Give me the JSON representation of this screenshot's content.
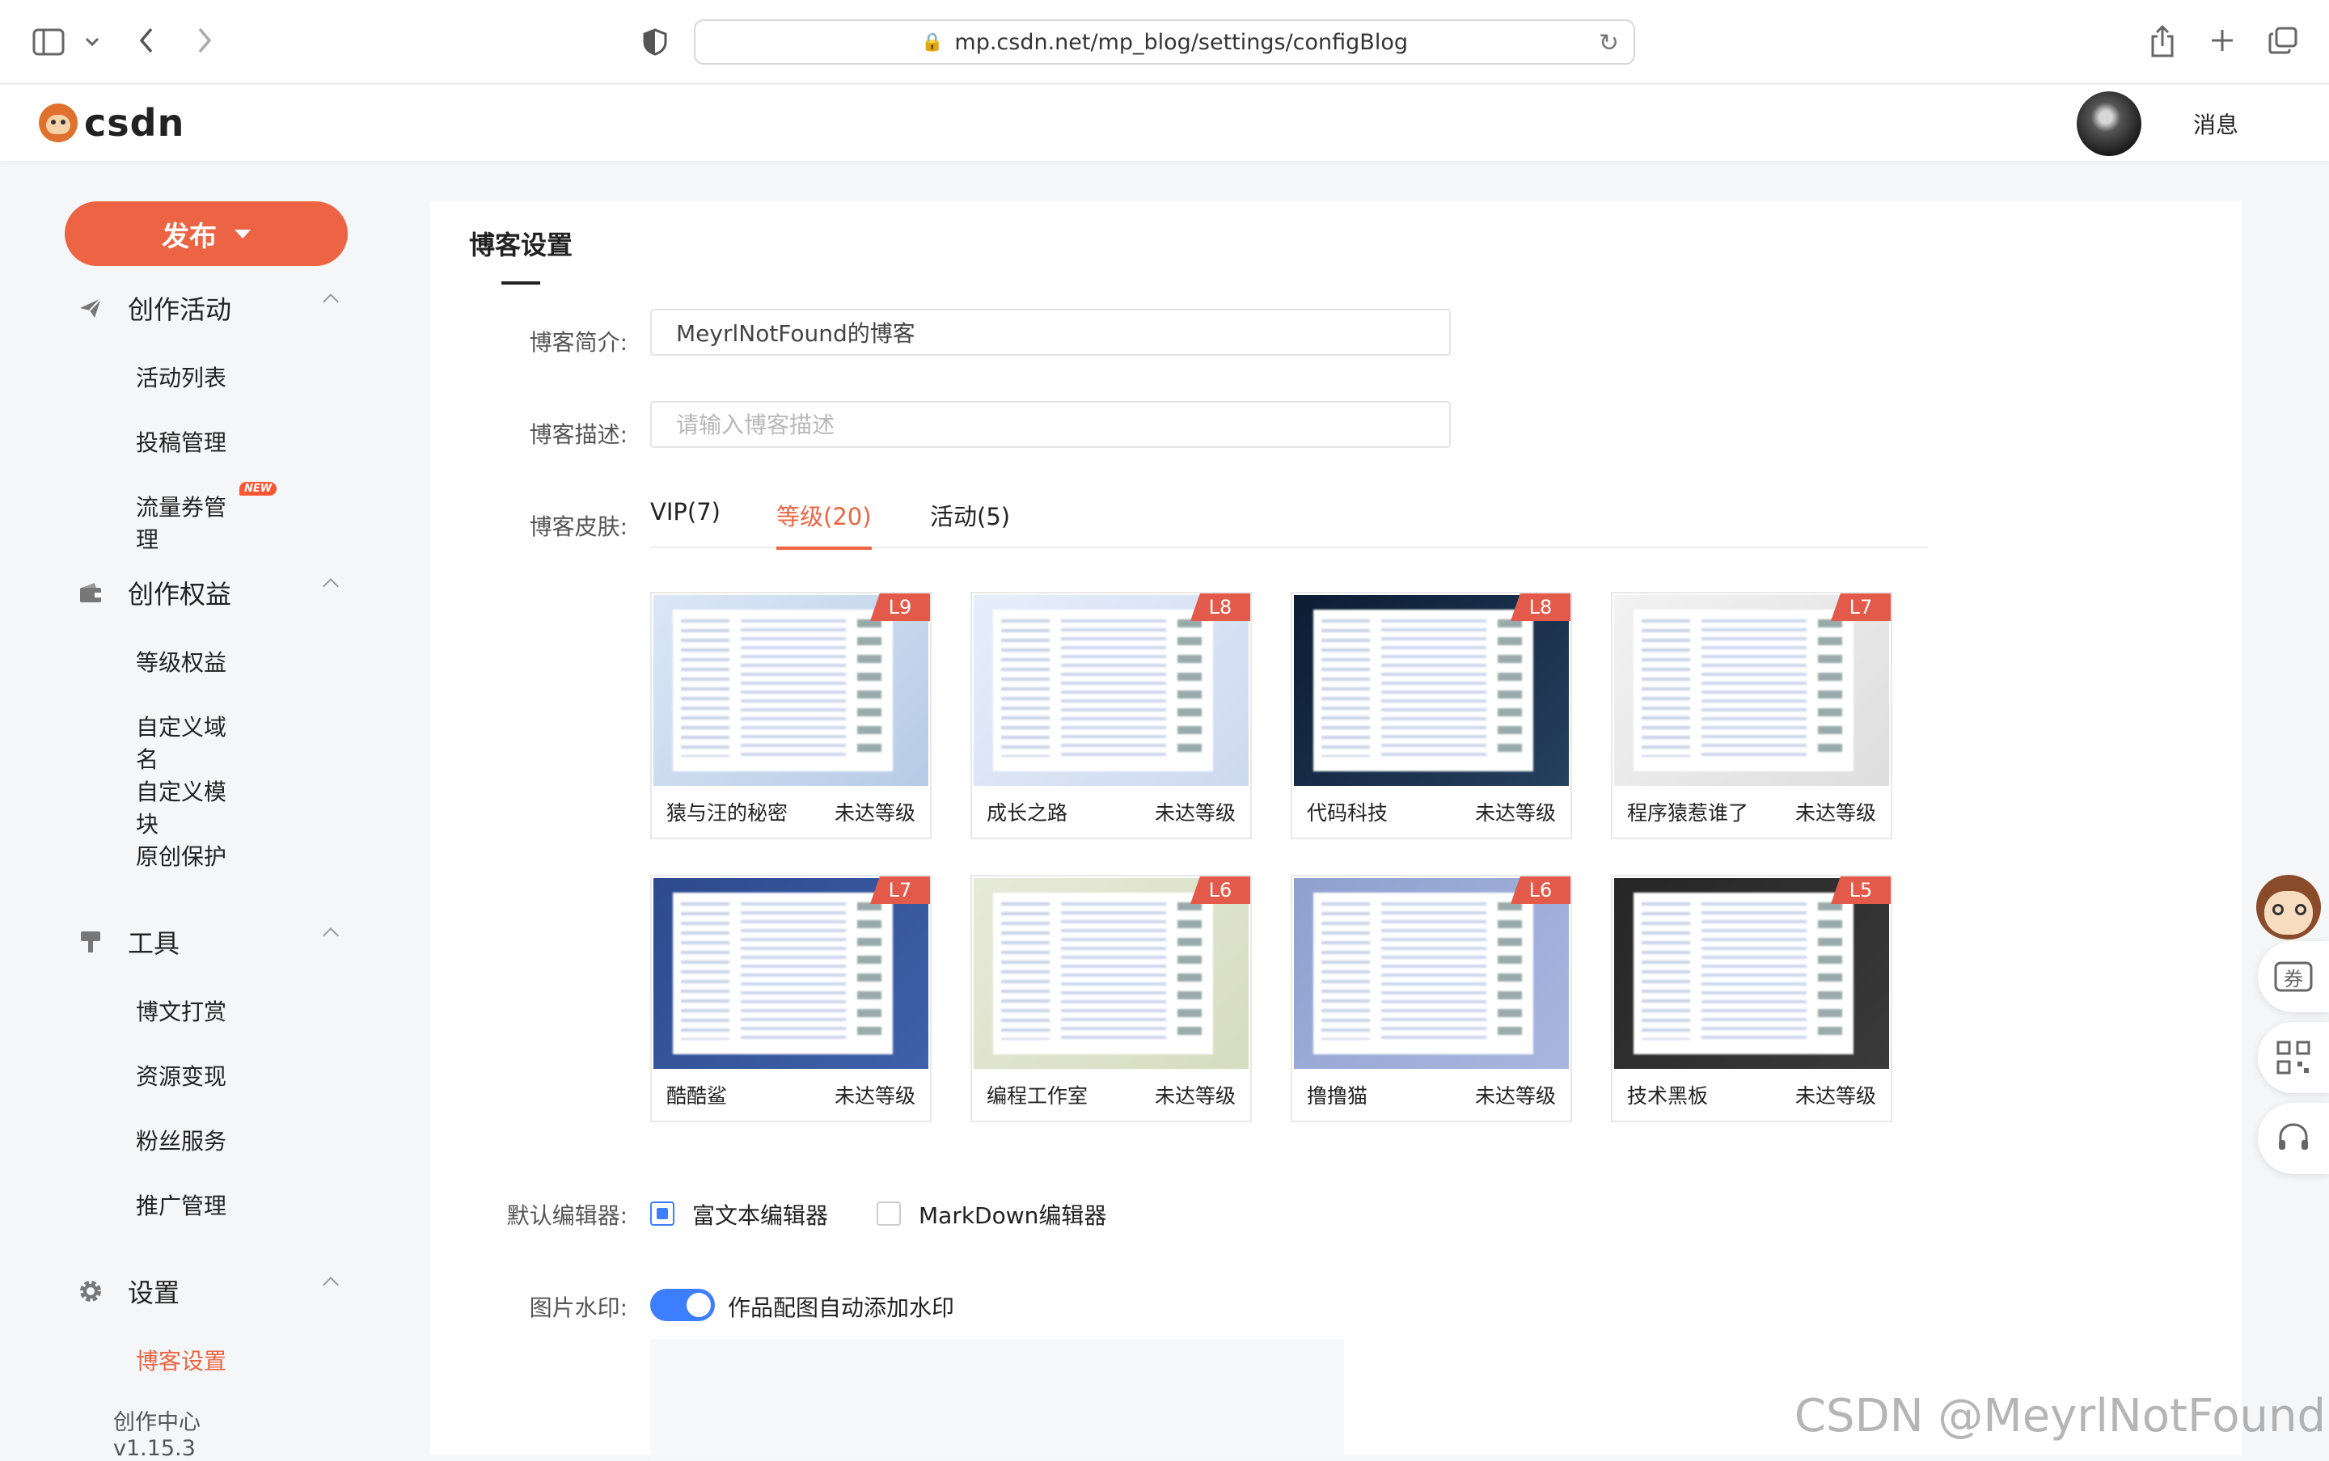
{
  "browser": {
    "url": "mp.csdn.net/mp_blog/settings/configBlog"
  },
  "header": {
    "logo_text": "csdn",
    "messages_label": "消息"
  },
  "sidebar": {
    "publish_label": "发布",
    "sections": [
      {
        "title": "创作活动",
        "icon": "paper-plane-icon",
        "items": [
          {
            "label": "活动列表"
          },
          {
            "label": "投稿管理"
          },
          {
            "label": "流量券管理",
            "badge": "NEW"
          }
        ]
      },
      {
        "title": "创作权益",
        "icon": "wallet-icon",
        "items": [
          {
            "label": "等级权益"
          },
          {
            "label": "自定义域名"
          },
          {
            "label": "自定义模块"
          },
          {
            "label": "原创保护"
          }
        ]
      },
      {
        "title": "工具",
        "icon": "tools-icon",
        "items": [
          {
            "label": "博文打赏"
          },
          {
            "label": "资源变现"
          },
          {
            "label": "粉丝服务"
          },
          {
            "label": "推广管理"
          }
        ]
      },
      {
        "title": "设置",
        "icon": "gear-icon",
        "items": [
          {
            "label": "博客设置",
            "active": true
          }
        ]
      }
    ],
    "version": "创作中心 v1.15.3"
  },
  "main": {
    "title": "博客设置",
    "intro": {
      "label": "博客简介:",
      "value": "MeyrlNotFound的博客"
    },
    "description": {
      "label": "博客描述:",
      "placeholder": "请输入博客描述"
    },
    "skin": {
      "label": "博客皮肤:",
      "tabs": [
        {
          "label": "VIP(7)"
        },
        {
          "label": "等级(20)",
          "active": true
        },
        {
          "label": "活动(5)"
        }
      ],
      "items": [
        {
          "name": "猿与汪的秘密",
          "status": "未达等级",
          "level": "L9",
          "bg": "#dbe7f7",
          "accent": "#b7cbe6"
        },
        {
          "name": "成长之路",
          "status": "未达等级",
          "level": "L8",
          "bg": "#e7eefb",
          "accent": "#cdd9f0"
        },
        {
          "name": "代码科技",
          "status": "未达等级",
          "level": "L8",
          "bg": "#0c1c33",
          "accent": "#26405f"
        },
        {
          "name": "程序猿惹谁了",
          "status": "未达等级",
          "level": "L7",
          "bg": "#f2f2f2",
          "accent": "#dedede"
        },
        {
          "name": "酷酷鲨",
          "status": "未达等级",
          "level": "L7",
          "bg": "#2d4a8e",
          "accent": "#3f60aa"
        },
        {
          "name": "编程工作室",
          "status": "未达等级",
          "level": "L6",
          "bg": "#e7ead9",
          "accent": "#d6dcc0"
        },
        {
          "name": "撸撸猫",
          "status": "未达等级",
          "level": "L6",
          "bg": "#8fa0cf",
          "accent": "#a9b7df"
        },
        {
          "name": "技术黑板",
          "status": "未达等级",
          "level": "L5",
          "bg": "#262626",
          "accent": "#3a3a3a"
        }
      ]
    },
    "editor": {
      "label": "默认编辑器:",
      "options": [
        {
          "label": "富文本编辑器",
          "checked": true
        },
        {
          "label": "MarkDown编辑器",
          "checked": false
        }
      ]
    },
    "watermark": {
      "label": "图片水印:",
      "toggle_label": "作品配图自动添加水印",
      "enabled": true
    }
  },
  "float_tools": [
    {
      "icon": "mascot-icon"
    },
    {
      "icon": "coupon-icon",
      "label": "券"
    },
    {
      "icon": "qrcode-icon"
    },
    {
      "icon": "headset-icon"
    }
  ],
  "page_watermark": "CSDN @MeyrlNotFound"
}
